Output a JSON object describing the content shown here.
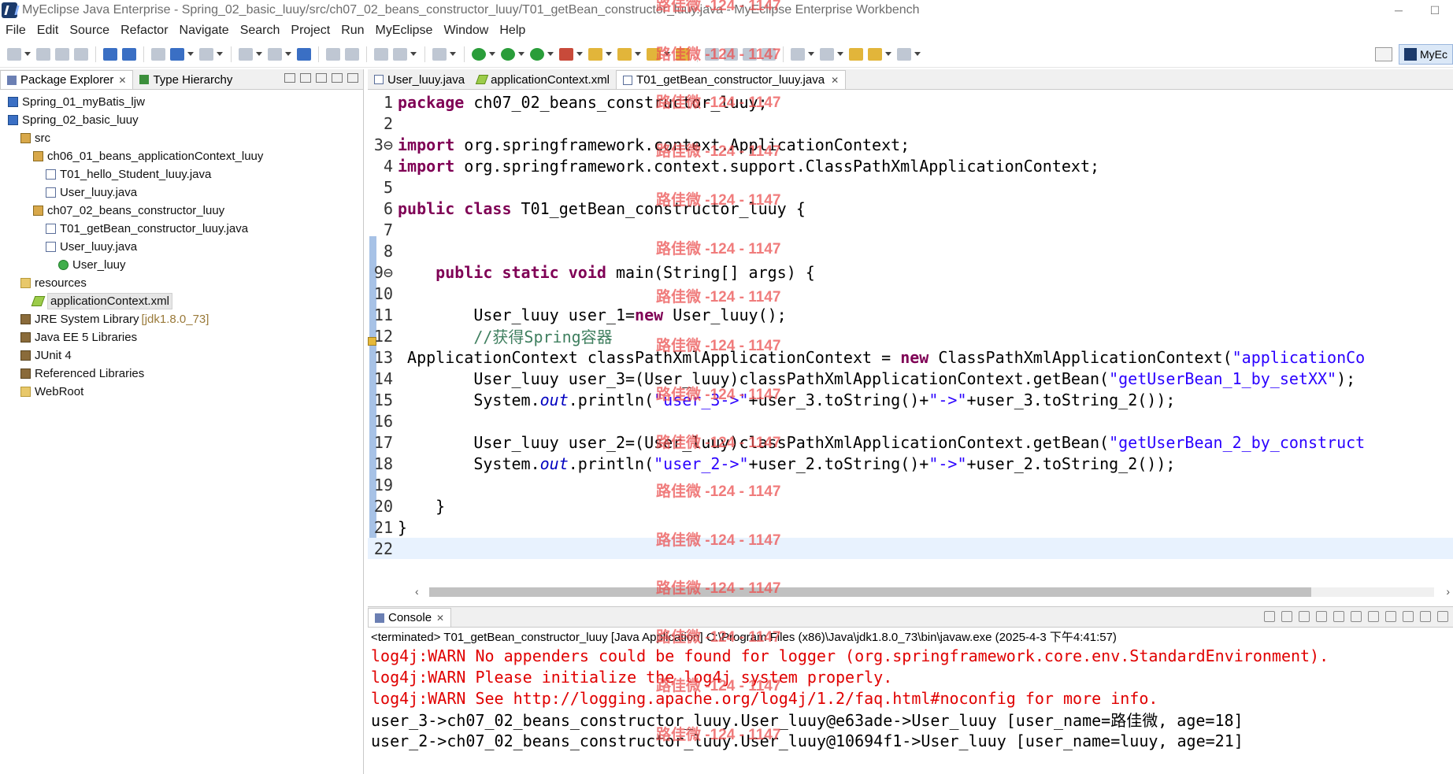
{
  "window": {
    "title": "MyEclipse Java Enterprise - Spring_02_basic_luuy/src/ch07_02_beans_constructor_luuy/T01_getBean_constructor_luuy.java - MyEclipse Enterprise Workbench",
    "minimize": "─",
    "maximize": "☐"
  },
  "menu": [
    "File",
    "Edit",
    "Source",
    "Refactor",
    "Navigate",
    "Search",
    "Project",
    "Run",
    "MyEclipse",
    "Window",
    "Help"
  ],
  "perspective": {
    "label": "MyEc"
  },
  "explorer": {
    "tabs": [
      {
        "label": "Package Explorer",
        "close": "✕"
      },
      {
        "label": "Type Hierarchy"
      }
    ],
    "tree": [
      {
        "label": "Spring_01_myBatis_ljw",
        "icon": "project-icon",
        "indent": 1
      },
      {
        "label": "Spring_02_basic_luuy",
        "icon": "project-icon",
        "indent": 1
      },
      {
        "label": "src",
        "icon": "source-folder-icon",
        "indent": 2
      },
      {
        "label": "ch06_01_beans_applicationContext_luuy",
        "icon": "package-icon",
        "indent": 3
      },
      {
        "label": "T01_hello_Student_luuy.java",
        "icon": "java-file-icon",
        "indent": 4
      },
      {
        "label": "User_luuy.java",
        "icon": "java-file-icon",
        "indent": 4
      },
      {
        "label": "ch07_02_beans_constructor_luuy",
        "icon": "package-icon",
        "indent": 3
      },
      {
        "label": "T01_getBean_constructor_luuy.java",
        "icon": "java-file-icon",
        "indent": 4
      },
      {
        "label": "User_luuy.java",
        "icon": "java-file-icon",
        "indent": 4
      },
      {
        "label": "User_luuy",
        "icon": "class-icon",
        "indent": 5
      },
      {
        "label": "resources",
        "icon": "folder-icon",
        "indent": 2
      },
      {
        "label": "applicationContext.xml",
        "icon": "xml-file-icon",
        "indent": 3,
        "selected": true
      },
      {
        "label": "JRE System Library",
        "suffix": "[jdk1.8.0_73]",
        "icon": "library-icon",
        "indent": 2
      },
      {
        "label": "Java EE 5 Libraries",
        "icon": "library-icon",
        "indent": 2
      },
      {
        "label": "JUnit 4",
        "icon": "library-icon",
        "indent": 2
      },
      {
        "label": "Referenced Libraries",
        "icon": "library-icon",
        "indent": 2
      },
      {
        "label": "WebRoot",
        "icon": "folder-icon",
        "indent": 2
      }
    ]
  },
  "editor": {
    "tabs": [
      {
        "label": "User_luuy.java",
        "icon": "java-file-icon"
      },
      {
        "label": "applicationContext.xml",
        "icon": "xml-file-icon"
      },
      {
        "label": "T01_getBean_constructor_luuy.java",
        "icon": "java-file-icon",
        "active": true,
        "close": "✕"
      }
    ],
    "lines": [
      {
        "n": "1",
        "tokens": [
          [
            "kw",
            "package"
          ],
          [
            "",
            " ch07_02_beans_constructor_luuy;"
          ]
        ]
      },
      {
        "n": "2",
        "tokens": []
      },
      {
        "n": "3⊖",
        "tokens": [
          [
            "kw",
            "import"
          ],
          [
            "",
            " org.springframework.context.ApplicationContext;"
          ]
        ]
      },
      {
        "n": "4",
        "tokens": [
          [
            "kw",
            "import"
          ],
          [
            "",
            " org.springframework.context.support.ClassPathXmlApplicationContext;"
          ]
        ]
      },
      {
        "n": "5",
        "tokens": []
      },
      {
        "n": "6",
        "tokens": [
          [
            "kw",
            "public"
          ],
          [
            "",
            " "
          ],
          [
            "kw",
            "class"
          ],
          [
            "",
            " T01_getBean_constructor_luuy {"
          ]
        ]
      },
      {
        "n": "7",
        "tokens": []
      },
      {
        "n": "8",
        "tokens": []
      },
      {
        "n": "9⊖",
        "tokens": [
          [
            "",
            "    "
          ],
          [
            "kw",
            "public"
          ],
          [
            "",
            " "
          ],
          [
            "kw",
            "static"
          ],
          [
            "",
            " "
          ],
          [
            "kw",
            "void"
          ],
          [
            "",
            " main(String[] args) {"
          ]
        ]
      },
      {
        "n": "10",
        "tokens": []
      },
      {
        "n": "11",
        "tokens": [
          [
            "",
            "        User_luuy user_1="
          ],
          [
            "kw",
            "new"
          ],
          [
            "",
            " User_luuy();"
          ]
        ]
      },
      {
        "n": "12",
        "tokens": [
          [
            "",
            "        "
          ],
          [
            "cmt",
            "//获得Spring容器"
          ]
        ]
      },
      {
        "n": "13",
        "tokens": [
          [
            "",
            " ApplicationContext classPathXmlApplicationContext = "
          ],
          [
            "kw",
            "new"
          ],
          [
            "",
            " ClassPathXmlApplicationContext("
          ],
          [
            "str",
            "\"applicationCo"
          ]
        ]
      },
      {
        "n": "14",
        "tokens": [
          [
            "",
            "        User_luuy user_3=(User_luuy)classPathXmlApplicationContext.getBean("
          ],
          [
            "str",
            "\"getUserBean_1_by_setXX\""
          ],
          [
            "",
            ");"
          ]
        ]
      },
      {
        "n": "15",
        "tokens": [
          [
            "",
            "        System."
          ],
          [
            "fld",
            "out"
          ],
          [
            "",
            ".println("
          ],
          [
            "str",
            "\"user_3->\""
          ],
          [
            "",
            "+user_3.toString()+"
          ],
          [
            "str",
            "\"->\""
          ],
          [
            "",
            "+user_3.toString_2());"
          ]
        ]
      },
      {
        "n": "16",
        "tokens": []
      },
      {
        "n": "17",
        "tokens": [
          [
            "",
            "        User_luuy user_2=(User_luuy)classPathXmlApplicationContext.getBean("
          ],
          [
            "str",
            "\"getUserBean_2_by_construct"
          ]
        ]
      },
      {
        "n": "18",
        "tokens": [
          [
            "",
            "        System."
          ],
          [
            "fld",
            "out"
          ],
          [
            "",
            ".println("
          ],
          [
            "str",
            "\"user_2->\""
          ],
          [
            "",
            "+user_2.toString()+"
          ],
          [
            "str",
            "\"->\""
          ],
          [
            "",
            "+user_2.toString_2());"
          ]
        ]
      },
      {
        "n": "19",
        "tokens": []
      },
      {
        "n": "20",
        "tokens": [
          [
            "",
            "    }"
          ]
        ]
      },
      {
        "n": "21",
        "tokens": [
          [
            "",
            "}"
          ]
        ]
      },
      {
        "n": "22",
        "tokens": [],
        "current": true
      }
    ]
  },
  "console": {
    "tab": {
      "label": "Console",
      "close": "✕"
    },
    "status": "<terminated> T01_getBean_constructor_luuy [Java Application] C:\\Program Files (x86)\\Java\\jdk1.8.0_73\\bin\\javaw.exe (2025-4-3 下午4:41:57)",
    "lines": [
      {
        "kind": "err",
        "text": "log4j:WARN No appenders could be found for logger (org.springframework.core.env.StandardEnvironment)."
      },
      {
        "kind": "err",
        "text": "log4j:WARN Please initialize the log4j system properly."
      },
      {
        "kind": "err",
        "text": "log4j:WARN See http://logging.apache.org/log4j/1.2/faq.html#noconfig for more info."
      },
      {
        "kind": "std",
        "text": "user_3->ch07_02_beans_constructor_luuy.User_luuy@e63ade->User_luuy [user_name=路佳微, age=18]"
      },
      {
        "kind": "std",
        "text": "user_2->ch07_02_beans_constructor_luuy.User_luuy@10694f1->User_luuy [user_name=luuy, age=21]"
      }
    ]
  },
  "watermark": "路佳微 -124 - 1147",
  "watermark_rows": [
    0,
    1,
    2,
    3,
    4,
    5,
    6,
    7,
    8,
    9,
    10,
    11,
    12,
    13,
    14,
    15
  ]
}
